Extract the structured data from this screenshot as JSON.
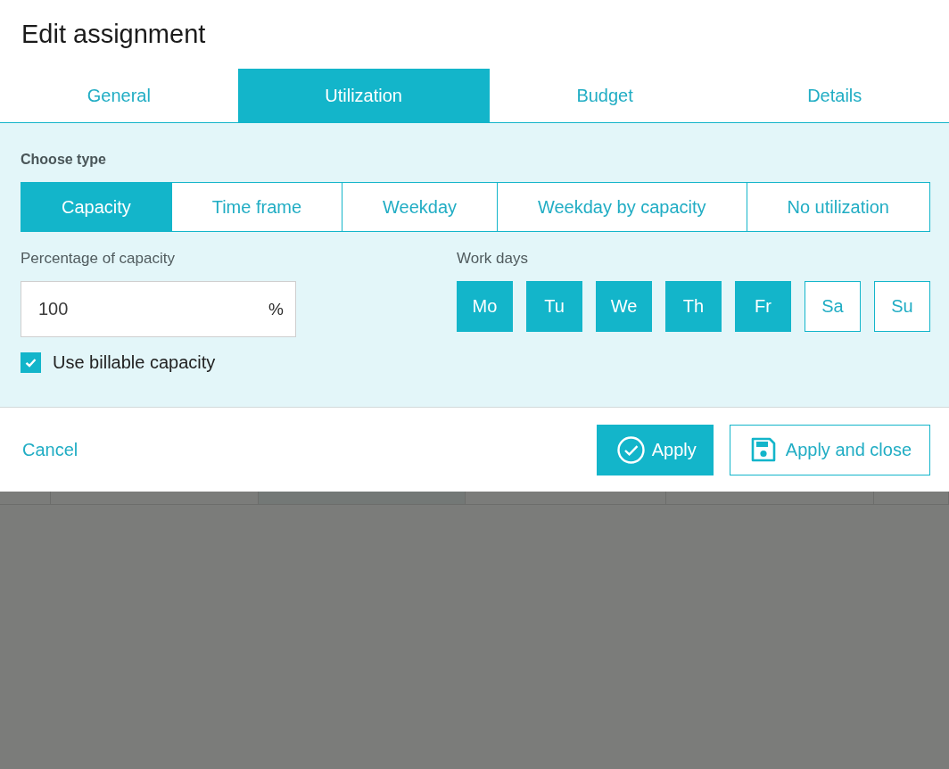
{
  "dialog": {
    "title": "Edit assignment"
  },
  "tabs": [
    {
      "label": "General",
      "selected": false
    },
    {
      "label": "Utilization",
      "selected": true
    },
    {
      "label": "Budget",
      "selected": false
    },
    {
      "label": "Details",
      "selected": false
    }
  ],
  "choose_type": {
    "label": "Choose type",
    "options": [
      {
        "label": "Capacity",
        "selected": true
      },
      {
        "label": "Time frame",
        "selected": false
      },
      {
        "label": "Weekday",
        "selected": false
      },
      {
        "label": "Weekday by capacity",
        "selected": false
      },
      {
        "label": "No utilization",
        "selected": false
      }
    ]
  },
  "percentage": {
    "label": "Percentage of capacity",
    "value": "100",
    "unit": "%"
  },
  "billable": {
    "label": "Use billable capacity",
    "checked": true
  },
  "work_days": {
    "label": "Work days",
    "days": [
      {
        "label": "Mo",
        "selected": true
      },
      {
        "label": "Tu",
        "selected": true
      },
      {
        "label": "We",
        "selected": true
      },
      {
        "label": "Th",
        "selected": true
      },
      {
        "label": "Fr",
        "selected": true
      },
      {
        "label": "Sa",
        "selected": false
      },
      {
        "label": "Su",
        "selected": false
      }
    ]
  },
  "footer": {
    "cancel": "Cancel",
    "buttons": [
      {
        "label": "Apply",
        "kind": "primary"
      },
      {
        "label": "Apply and close",
        "kind": "secondary"
      }
    ]
  }
}
